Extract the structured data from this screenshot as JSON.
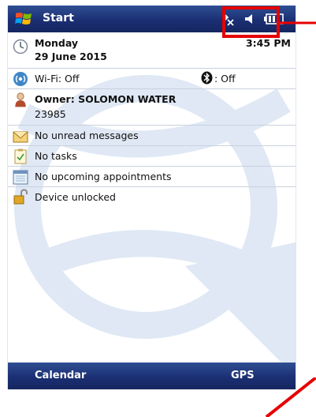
{
  "topbar": {
    "title": "Start",
    "icons": [
      "windows-flag-icon",
      "connectivity-icon",
      "volume-muted-icon",
      "battery-icon"
    ]
  },
  "datetime": {
    "day": "Monday",
    "date": "29 June 2015",
    "time": "3:45 PM"
  },
  "wireless": {
    "wifi": "Wi-Fi: Off",
    "bluetooth": ": Off"
  },
  "owner": {
    "name": "Owner: SOLOMON WATER",
    "number": "23985"
  },
  "messages": {
    "text": "No unread messages"
  },
  "tasks": {
    "text": "No tasks"
  },
  "appointments": {
    "text": "No upcoming appointments"
  },
  "lock": {
    "text": "Device unlocked"
  },
  "softkeys": {
    "left": "Calendar",
    "right": "GPS"
  },
  "colors": {
    "bar": "#1b2f73",
    "accent": "#e60000",
    "divider": "#c9d1df"
  }
}
